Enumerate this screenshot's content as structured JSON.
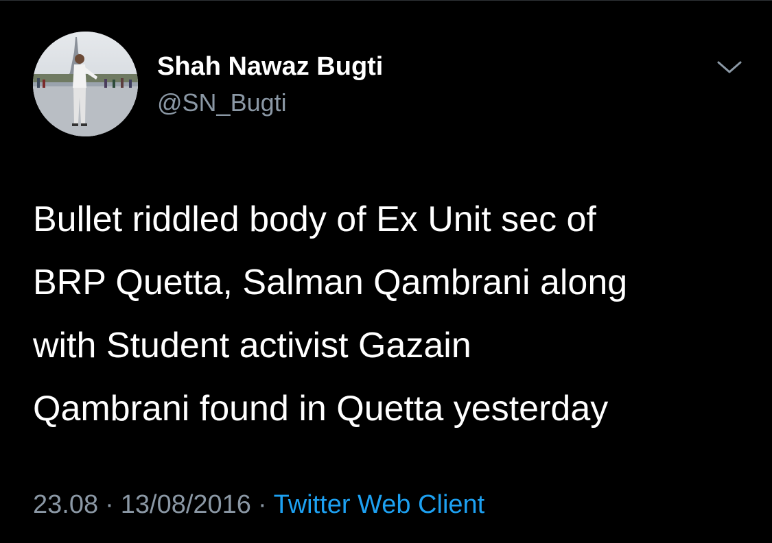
{
  "tweet": {
    "author": {
      "display_name": "Shah Nawaz Bugti",
      "handle": "@SN_Bugti",
      "avatar": "profile-photo-person-at-eiffel-tower"
    },
    "menu_icon": "chevron-down-icon",
    "text_lines": [
      "Bullet riddled body of Ex Unit sec of",
      "BRP Quetta, Salman Qambrani along",
      "with Student activist Gazain",
      "Qambrani found in Quetta yesterday"
    ],
    "meta": {
      "time": "23.08",
      "separator": "·",
      "date": "13/08/2016",
      "client": "Twitter Web Client"
    }
  },
  "colors": {
    "background": "#000000",
    "primary_text": "#ffffff",
    "secondary_text": "#8b98a5",
    "link": "#1da1f2"
  }
}
